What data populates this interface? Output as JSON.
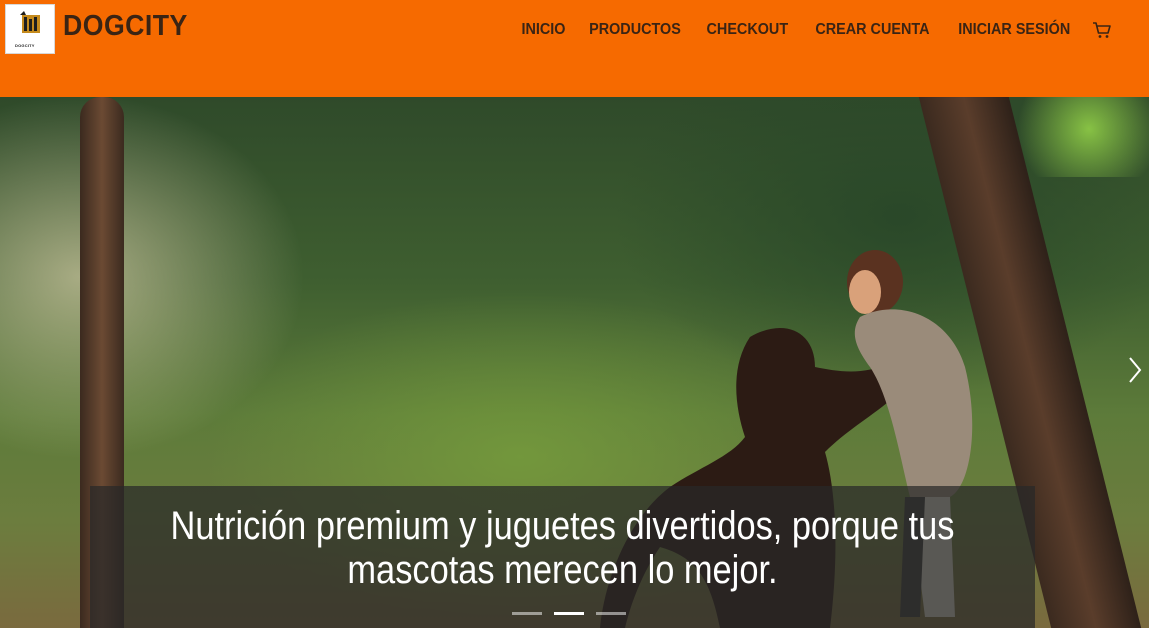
{
  "brand": {
    "logo_text": "DOGCITY",
    "name": "DOGCITY"
  },
  "nav": {
    "items": [
      "INICIO",
      "PRODUCTOS",
      "CHECKOUT",
      "CREAR CUENTA",
      "INICIAR SESIÓN"
    ],
    "cart_icon": "shopping-cart-icon"
  },
  "hero": {
    "caption": "Nutrición premium y juguetes divertidos, porque tus mascotas merecen lo mejor.",
    "slides_total": 3,
    "active_slide": 2,
    "next_icon": "chevron-right-icon"
  },
  "colors": {
    "navbar": "#f66a00",
    "nav_text": "#3a2414",
    "caption_bg": "rgba(40,40,40,0.72)"
  }
}
